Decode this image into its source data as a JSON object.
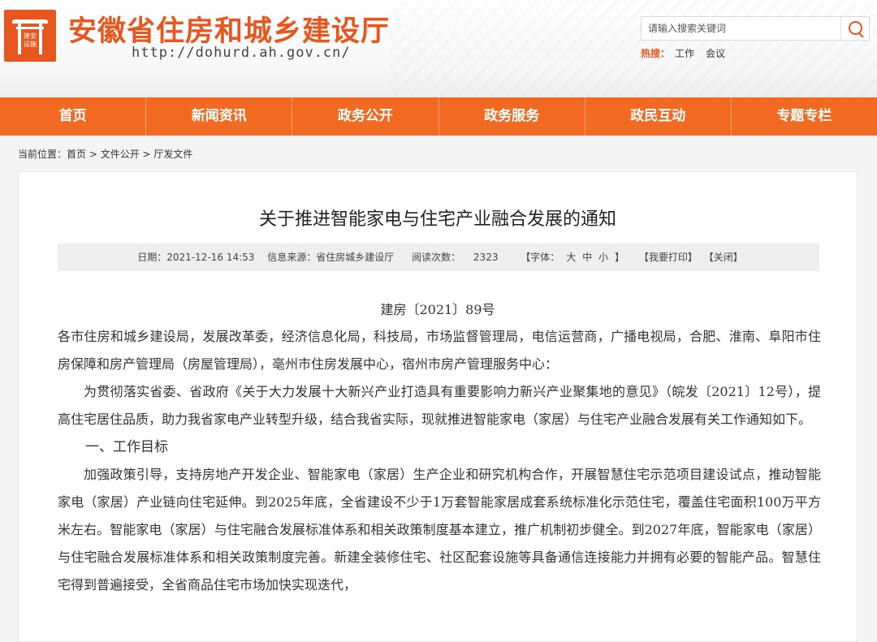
{
  "header": {
    "logo_text": "建安设施",
    "site_title": "安徽省住房和城乡建设厅",
    "site_url": "http://dohurd.ah.gov.cn/",
    "search_placeholder": "请输入搜索关键词",
    "hot_label": "热搜：",
    "hot_links": [
      "工作",
      "会议"
    ]
  },
  "nav": {
    "items": [
      "首页",
      "新闻资讯",
      "政务公开",
      "政务服务",
      "政民互动",
      "专题专栏"
    ]
  },
  "breadcrumb": {
    "prefix": "当前位置：",
    "items": [
      "首页",
      "文件公开",
      "厅发文件"
    ],
    "separator": " > "
  },
  "article": {
    "title": "关于推进智能家电与住宅产业融合发展的通知",
    "meta": {
      "date": "日期：2021-12-16 14:53",
      "source": "信息来源：省住房城乡建设厅",
      "views_label": "阅读次数：",
      "views": "2323",
      "font_label": "【字体：",
      "font_large": "大",
      "font_medium": "中",
      "font_small": "小",
      "font_end": "】",
      "print": "【我要打印】",
      "close": "【关闭】"
    },
    "doc_number": "建房〔2021〕89号",
    "addressee": "各市住房和城乡建设局，发展改革委，经济信息化局，科技局，市场监督管理局，电信运营商，广播电视局，合肥、淮南、阜阳市住房保障和房产管理局（房屋管理局），亳州市住房发展中心，宿州市房产管理服务中心：",
    "intro": "为贯彻落实省委、省政府《关于大力发展十大新兴产业打造具有重要影响力新兴产业聚集地的意见》（皖发〔2021〕12号），提高住宅居住品质，助力我省家电产业转型升级，结合我省实际，现就推进智能家电（家居）与住宅产业融合发展有关工作通知如下。",
    "section1_heading": "一、工作目标",
    "section1_body": "加强政策引导，支持房地产开发企业、智能家电（家居）生产企业和研究机构合作，开展智慧住宅示范项目建设试点，推动智能家电（家居）产业链向住宅延伸。到2025年底，全省建设不少于1万套智能家居成套系统标准化示范住宅，覆盖住宅面积100万平方米左右。智能家电（家居）与住宅融合发展标准体系和相关政策制度基本建立，推广机制初步健全。到2027年底，智能家电（家居）与住宅融合发展标准体系和相关政策制度完善。新建全装修住宅、社区配套设施等具备通信连接能力并拥有必要的智能产品。智慧住宅得到普遍接受，全省商品住宅市场加快实现迭代，"
  },
  "colors": {
    "brand_orange": "#e8561e",
    "nav_orange": "#f26a21"
  }
}
